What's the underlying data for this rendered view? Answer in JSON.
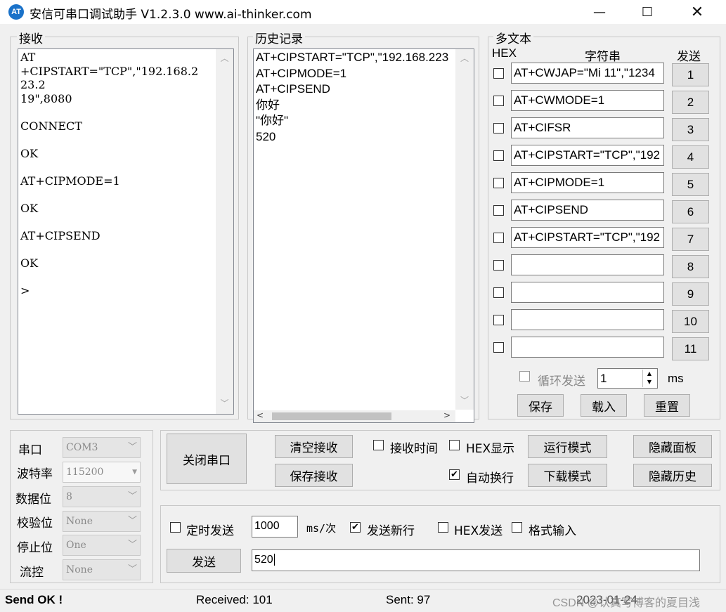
{
  "window": {
    "icon_text": "AT",
    "title": "安信可串口调试助手 V1.2.3.0    www.ai-thinker.com",
    "minimize": "—",
    "maximize": "☐",
    "close": "✕"
  },
  "receive": {
    "title": "接收",
    "text": "AT\n+CIPSTART=\"TCP\",\"192.168.2\n23.2\n19\",8080\n\nCONNECT\n\nOK\n\nAT+CIPMODE=1\n\nOK\n\nAT+CIPSEND\n\nOK\n\n>"
  },
  "history": {
    "title": "历史记录",
    "text": "AT+CIPSTART=\"TCP\",\"192.168.223\nAT+CIPMODE=1\nAT+CIPSEND\n你好\n\"你好\"\n520"
  },
  "multitext": {
    "title": "多文本",
    "col_hex": "HEX",
    "col_string": "字符串",
    "col_send": "发送",
    "rows": [
      {
        "checked": false,
        "value": "AT+CWJAP=\"Mi 11\",\"1234",
        "button": "1"
      },
      {
        "checked": false,
        "value": "AT+CWMODE=1",
        "button": "2"
      },
      {
        "checked": false,
        "value": "AT+CIFSR",
        "button": "3"
      },
      {
        "checked": false,
        "value": "AT+CIPSTART=\"TCP\",\"192",
        "button": "4"
      },
      {
        "checked": false,
        "value": "AT+CIPMODE=1",
        "button": "5"
      },
      {
        "checked": false,
        "value": "AT+CIPSEND",
        "button": "6"
      },
      {
        "checked": false,
        "value": "AT+CIPSTART=\"TCP\",\"192",
        "button": "7"
      },
      {
        "checked": false,
        "value": "",
        "button": "8"
      },
      {
        "checked": false,
        "value": "",
        "button": "9"
      },
      {
        "checked": false,
        "value": "",
        "button": "10"
      },
      {
        "checked": false,
        "value": "",
        "button": "11"
      }
    ],
    "loop_send_label": "循环发送",
    "loop_value": "1",
    "loop_unit": "ms",
    "save_button": "保存",
    "load_button": "载入",
    "reset_button": "重置"
  },
  "serial": {
    "port_label": "串口",
    "port_value": "COM3",
    "baud_label": "波特率",
    "baud_value": "115200",
    "databits_label": "数据位",
    "databits_value": "8",
    "parity_label": "校验位",
    "parity_value": "None",
    "stopbits_label": "停止位",
    "stopbits_value": "One",
    "flow_label": "流控",
    "flow_value": "None"
  },
  "controls": {
    "close_port": "关闭串口",
    "clear_receive": "清空接收",
    "save_receive": "保存接收",
    "recv_time_label": "接收时间",
    "hex_display_label": "HEX显示",
    "auto_newline_label": "自动换行",
    "auto_newline_checked": true,
    "run_mode": "运行模式",
    "download_mode": "下载模式",
    "hide_panel": "隐藏面板",
    "hide_history": "隐藏历史"
  },
  "send": {
    "timed_send_label": "定时发送",
    "interval_value": "1000",
    "interval_unit": "ms/次",
    "send_newline_label": "发送新行",
    "send_newline_checked": true,
    "hex_send_label": "HEX发送",
    "format_input_label": "格式输入",
    "send_button": "发送",
    "send_text": "520"
  },
  "status": {
    "message": "Send OK !",
    "received": "Received: 101",
    "sent": "Sent: 97",
    "datetime": "2023-01-24",
    "watermark": "CSDN @认真写博客的夏目浅"
  }
}
